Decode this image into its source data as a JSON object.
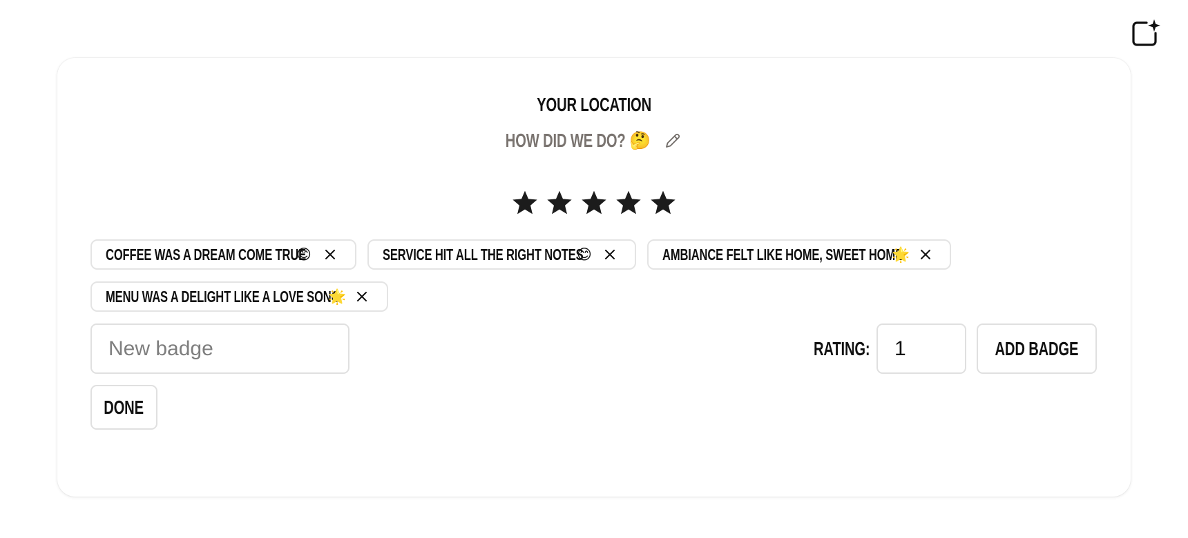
{
  "header": {
    "corner_icon": "new-chat-sparkle-icon"
  },
  "review": {
    "title": "Your Location",
    "subtitle": "How did we do?",
    "subtitle_emoji": "🤔",
    "edit_icon": "pencil-icon",
    "rating_stars_filled": 5,
    "rating_stars_total": 5
  },
  "badges": [
    {
      "label": "Coffee was a dream come true",
      "emoji": "😊"
    },
    {
      "label": "Service hit all the right notes",
      "emoji": "😊"
    },
    {
      "label": "Ambiance felt like home, sweet home",
      "emoji": "🌟"
    },
    {
      "label": "Menu was a delight like a love song",
      "emoji": "🌟"
    }
  ],
  "form": {
    "new_badge_placeholder": "New badge",
    "new_badge_value": "",
    "rating_label": "Rating:",
    "rating_value": "1",
    "add_button_label": "Add Badge",
    "done_button_label": "Done"
  },
  "colors": {
    "star": "#1c1c1c",
    "subtitle": "#7a7470",
    "border": "#e0e0e0"
  }
}
